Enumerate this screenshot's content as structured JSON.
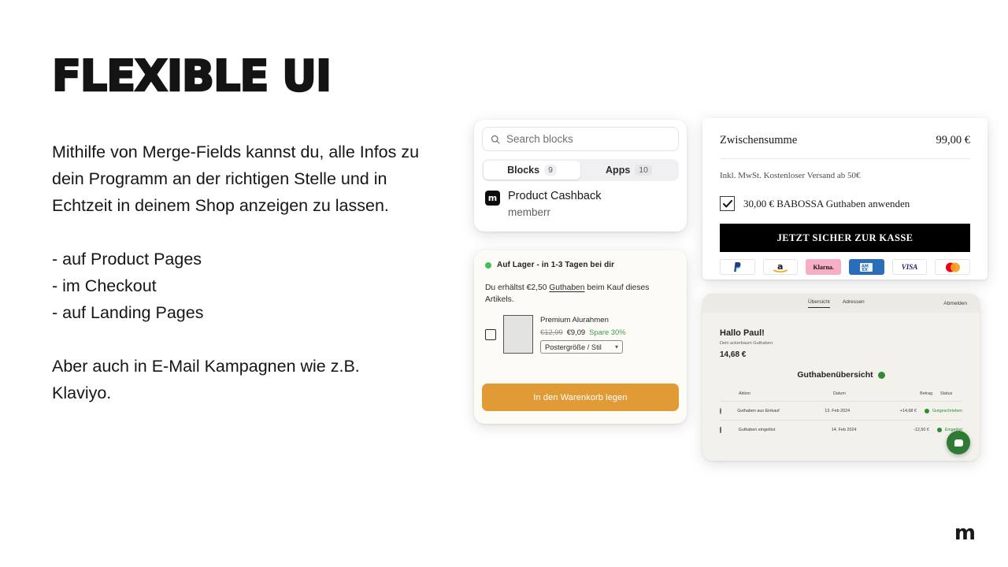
{
  "slide": {
    "headline": "FLEXIBLE UI",
    "paragraph": "Mithilfe von Merge-Fields kannst du, alle Infos zu dein Programm an der richtigen Stelle und in Echtzeit in deinem Shop anzeigen zu lassen.",
    "bullets": [
      "- auf Product Pages",
      "- im Checkout",
      "- auf Landing Pages"
    ],
    "closing": "Aber auch in E-Mail Kampagnen wie z.B. Klaviyo.",
    "brand_mark": "m"
  },
  "blocks_card": {
    "search_placeholder": "Search blocks",
    "search_icon": "search-icon",
    "tabs": [
      {
        "label": "Blocks",
        "count": "9",
        "active": true
      },
      {
        "label": "Apps",
        "count": "10",
        "active": false
      }
    ],
    "item": {
      "logo_glyph": "m",
      "title": "Product Cashback",
      "subtitle": "memberr"
    }
  },
  "product_card": {
    "stock_status": "Auf Lager - in 1-3 Tagen bei dir",
    "stock_dot_color": "#3ec25a",
    "credit_text_before": "Du erhältst €2,50 ",
    "credit_link": "Guthaben",
    "credit_text_after": " beim Kauf dieses Artikels.",
    "item_name": "Premium Alurahmen",
    "price_old": "€12,99",
    "price_new": "€9,09",
    "save_label": "Spare 30%",
    "save_color": "#3f9a4f",
    "variant_select": "Postergröße / Stil",
    "cta": "In den Warenkorb legen",
    "cta_color": "#e09a36"
  },
  "checkout_card": {
    "subtotal_label": "Zwischensumme",
    "subtotal_value": "99,00 €",
    "note": "Inkl. MwSt. Kostenloser Versand ab 50€",
    "credit_checkbox_label": "30,00 € BABOSSA Guthaben anwenden",
    "credit_checkbox_checked": true,
    "cta": "JETZT SICHER ZUR KASSE",
    "cta_color": "#000000",
    "payments": [
      {
        "name": "paypal-icon",
        "label": "P"
      },
      {
        "name": "amazon-icon",
        "label": "a"
      },
      {
        "name": "klarna-icon",
        "label": "Klarna."
      },
      {
        "name": "amex-icon",
        "label": "AMEX"
      },
      {
        "name": "visa-icon",
        "label": "VISA"
      },
      {
        "name": "mastercard-icon",
        "label": ""
      }
    ]
  },
  "dashboard_card": {
    "nav": [
      {
        "label": "Übersicht",
        "active": true
      },
      {
        "label": "Adressen",
        "active": false
      }
    ],
    "logout": "Abmelden",
    "greeting": "Hallo Paul!",
    "balance_label": "Dein ackerbaum Guthaben:",
    "balance_value": "14,68 €",
    "section_title": "Guthabenübersicht",
    "badge_color": "#2f8b34",
    "table": {
      "columns": [
        "Aktion",
        "Datum",
        "Betrag",
        "Status"
      ],
      "rows": [
        {
          "icon": "coin-icon",
          "action": "Guthaben aus Einkauf",
          "date": "13. Feb 2024",
          "amount": "+14,68 €",
          "status": "Gutgeschrieben"
        },
        {
          "icon": "card-icon",
          "action": "Guthaben eingelöst",
          "date": "14. Feb 2024",
          "amount": "-12,50 €",
          "status": "Eingelöst"
        }
      ]
    },
    "fab": "chat-button"
  }
}
